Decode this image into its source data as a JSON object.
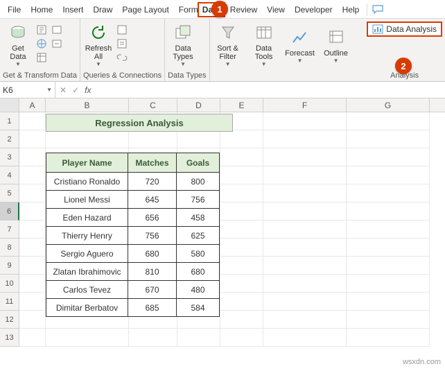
{
  "tabs": [
    "File",
    "Home",
    "Insert",
    "Draw",
    "Page Layout",
    "Formulas",
    "Data",
    "Review",
    "View",
    "Developer",
    "Help"
  ],
  "active_tab": "Data",
  "ribbon": {
    "get_data": "Get\nData",
    "refresh": "Refresh\nAll",
    "data_types": "Data\nTypes",
    "sort_filter": "Sort &\nFilter",
    "data_tools": "Data\nTools",
    "forecast": "Forecast",
    "outline": "Outline",
    "data_analysis": "Data Analysis",
    "groups": {
      "g1": "Get & Transform Data",
      "g2": "Queries & Connections",
      "g3": "Data Types",
      "g4": "Analysis"
    }
  },
  "namebox": "K6",
  "columns": [
    "A",
    "B",
    "C",
    "D",
    "E",
    "F",
    "G"
  ],
  "row_numbers": [
    "1",
    "2",
    "3",
    "4",
    "5",
    "6",
    "7",
    "8",
    "9",
    "10",
    "11",
    "12",
    "13"
  ],
  "selected_row": 6,
  "title": "Regression Analysis",
  "headers": {
    "name": "Player Name",
    "matches": "Matches",
    "goals": "Goals"
  },
  "players": [
    {
      "name": "Cristiano Ronaldo",
      "matches": "720",
      "goals": "800"
    },
    {
      "name": "Lionel Messi",
      "matches": "645",
      "goals": "756"
    },
    {
      "name": "Eden Hazard",
      "matches": "656",
      "goals": "458"
    },
    {
      "name": "Thierry Henry",
      "matches": "756",
      "goals": "625"
    },
    {
      "name": "Sergio Aguero",
      "matches": "680",
      "goals": "580"
    },
    {
      "name": "Zlatan Ibrahimovic",
      "matches": "810",
      "goals": "680"
    },
    {
      "name": "Carlos Tevez",
      "matches": "670",
      "goals": "480"
    },
    {
      "name": "Dimitar Berbatov",
      "matches": "685",
      "goals": "584"
    }
  ],
  "callouts": {
    "c1": "1",
    "c2": "2"
  },
  "watermark": "wsxdn.com"
}
